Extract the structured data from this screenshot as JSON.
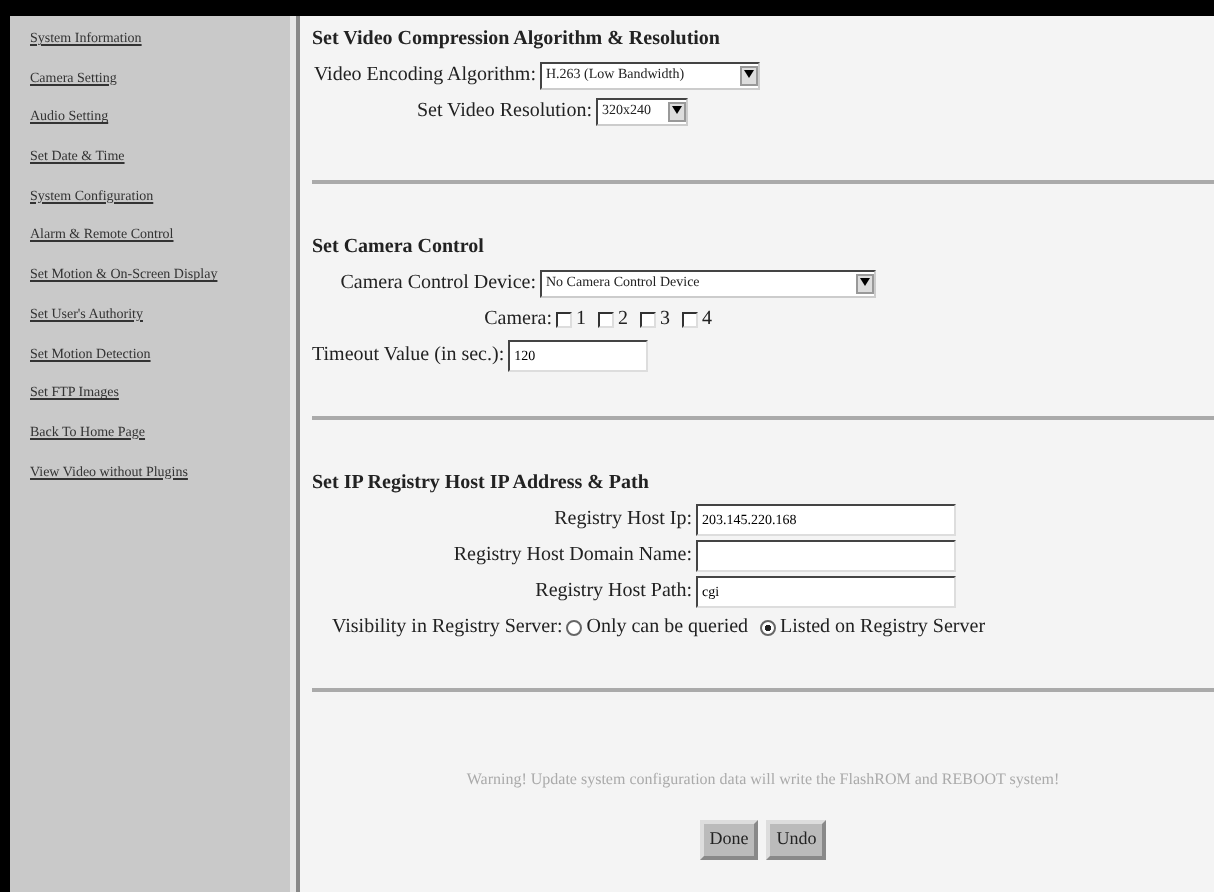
{
  "sidebar": {
    "items": [
      {
        "label": "System Information"
      },
      {
        "label": "Camera Setting"
      },
      {
        "label": "Audio Setting"
      },
      {
        "label": "Set Date & Time"
      },
      {
        "label": "System Configuration"
      },
      {
        "label": "Alarm & Remote Control"
      },
      {
        "label": "Set Motion & On-Screen Display"
      },
      {
        "label": "Set User's Authority"
      },
      {
        "label": "Set Motion Detection"
      },
      {
        "label": "Set FTP Images"
      },
      {
        "label": "Back To Home Page"
      },
      {
        "label": "View Video without Plugins"
      }
    ]
  },
  "sections": [
    {
      "title": "Set Video Compression Algorithm & Resolution",
      "fields": [
        {
          "kind": "select",
          "label": "Video Encoding Algorithm:",
          "value": "H.263 (Low Bandwidth)"
        },
        {
          "kind": "select",
          "label": "Set Video Resolution:",
          "value": "320x240"
        }
      ]
    },
    {
      "title": "Set Camera Control",
      "fields": [
        {
          "kind": "select",
          "label": "Camera Control Device:",
          "value": "No Camera Control Device"
        },
        {
          "kind": "checks",
          "label": "Camera:",
          "options": [
            {
              "label": "1",
              "checked": false
            },
            {
              "label": "2",
              "checked": false
            },
            {
              "label": "3",
              "checked": false
            },
            {
              "label": "4",
              "checked": false
            }
          ]
        },
        {
          "kind": "text",
          "label": "Timeout Value (in sec.):",
          "value": "120"
        }
      ]
    },
    {
      "title": "Set IP Registry Host IP Address & Path",
      "fields": [
        {
          "kind": "text",
          "label": "Registry Host Ip:",
          "value": "203.145.220.168"
        },
        {
          "kind": "text",
          "label": "Registry Host Domain Name:"
        },
        {
          "kind": "text",
          "label": "Registry Host Path:",
          "value": "cgi"
        },
        {
          "kind": "radios",
          "label": "Visibility in Registry Server:",
          "options": [
            {
              "label": "Only can be queried",
              "selected": false
            },
            {
              "label": "Listed on Registry Server",
              "selected": true
            }
          ]
        }
      ]
    }
  ],
  "warning": "Warning! Update system configuration data will write the FlashROM and REBOOT system!",
  "buttons": [
    "Done",
    "Undo"
  ]
}
